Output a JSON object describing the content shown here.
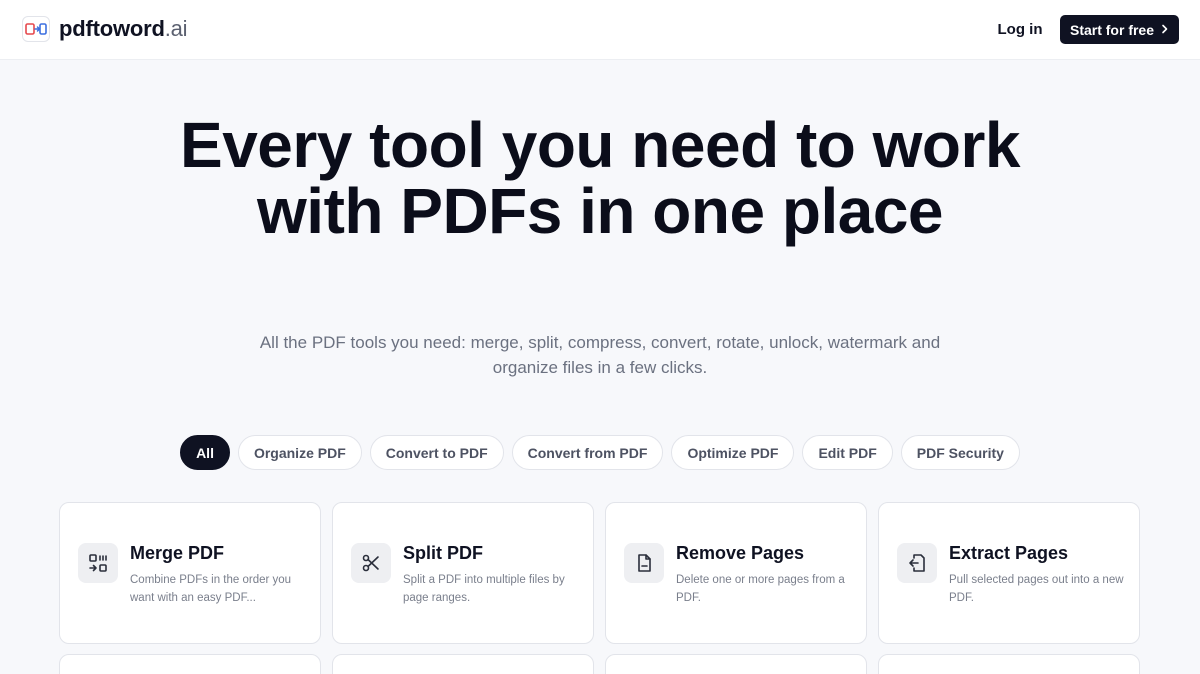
{
  "header": {
    "brand_name": "pdftoword",
    "brand_tld": ".ai",
    "login_label": "Log in",
    "start_label": "Start for free"
  },
  "hero": {
    "title": "Every tool you need to work with PDFs in one place",
    "subtitle": "All the PDF tools you need: merge, split, compress, convert, rotate, unlock, watermark and organize files in a few clicks."
  },
  "filters": [
    "All",
    "Organize PDF",
    "Convert to PDF",
    "Convert from PDF",
    "Optimize PDF",
    "Edit PDF",
    "PDF Security"
  ],
  "active_filter": "All",
  "tools": [
    {
      "title": "Merge PDF",
      "description": "Combine PDFs in the order you want with an easy PDF...",
      "icon": "merge-icon"
    },
    {
      "title": "Split PDF",
      "description": "Split a PDF into multiple files by page ranges.",
      "icon": "scissors-icon"
    },
    {
      "title": "Remove Pages",
      "description": "Delete one or more pages from a PDF.",
      "icon": "file-remove-icon"
    },
    {
      "title": "Extract Pages",
      "description": "Pull selected pages out into a new PDF.",
      "icon": "file-export-icon"
    }
  ],
  "colors": {
    "accent_dark": "#0f1222",
    "page_bg": "#f7f8fb",
    "logo_blue": "#3b6fe0",
    "logo_red": "#e5484d"
  }
}
